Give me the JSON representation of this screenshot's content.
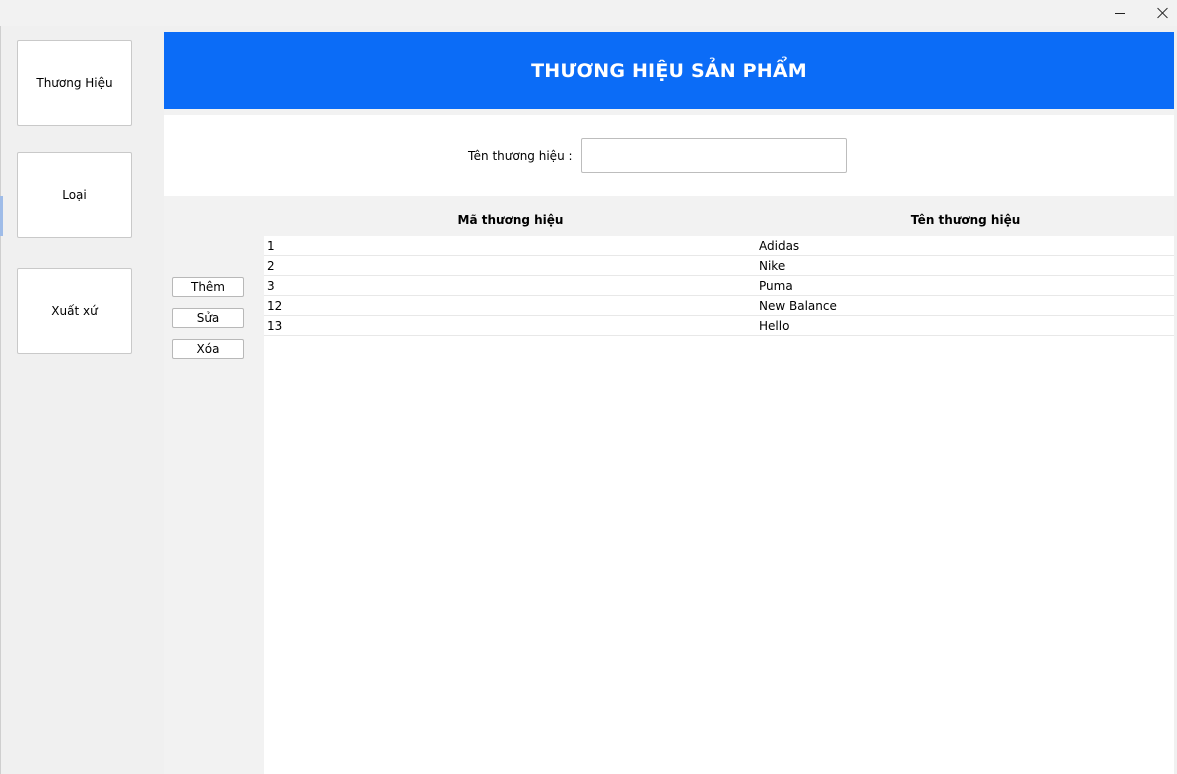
{
  "window": {
    "minimize_glyph": "minimize-icon",
    "close_glyph": "close-icon"
  },
  "sidebar": {
    "items": [
      {
        "label": "Thương Hiệu"
      },
      {
        "label": "Loại"
      },
      {
        "label": "Xuất xứ"
      }
    ]
  },
  "header": {
    "title": "THƯƠNG HIỆU SẢN PHẨM"
  },
  "form": {
    "label": "Tên thương hiệu :",
    "value": "",
    "placeholder": ""
  },
  "actions": {
    "add": "Thêm",
    "edit": "Sửa",
    "delete": "Xóa"
  },
  "table": {
    "columns": [
      "Mã thương hiệu",
      "Tên thương hiệu"
    ],
    "rows": [
      {
        "id": "1",
        "name": "Adidas"
      },
      {
        "id": "2",
        "name": "Nike"
      },
      {
        "id": "3",
        "name": "Puma"
      },
      {
        "id": "12",
        "name": "New Balance"
      },
      {
        "id": "13",
        "name": "Hello"
      }
    ]
  },
  "colors": {
    "header_bg": "#0b6cf7",
    "header_text": "#ffffff"
  }
}
